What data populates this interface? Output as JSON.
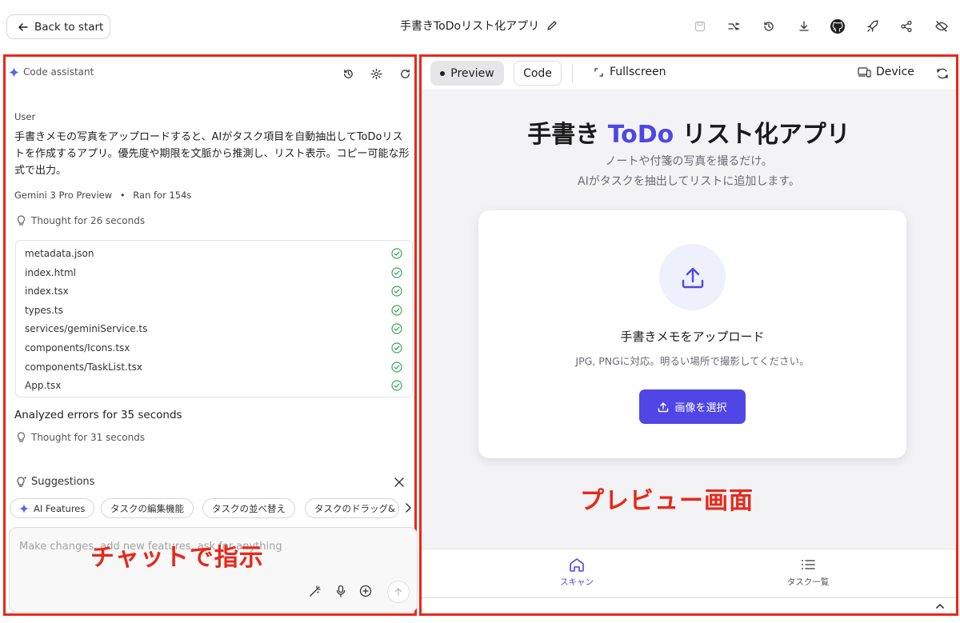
{
  "topbar": {
    "back_label": "Back to start",
    "app_title": "手書きToDoリスト化アプリ"
  },
  "chat": {
    "header_label": "Code assistant",
    "user_label": "User",
    "user_message": "手書きメモの写真をアップロードすると、AIがタスク項目を自動抽出してToDoリストを作成するアプリ。優先度や期限を文脈から推測し、リスト表示。コピー可能な形式で出力。",
    "model_name": "Gemini 3 Pro Preview",
    "run_time": "Ran for 154s",
    "thought_1": "Thought for 26 seconds",
    "files": [
      "metadata.json",
      "index.html",
      "index.tsx",
      "types.ts",
      "services/geminiService.ts",
      "components/Icons.tsx",
      "components/TaskList.tsx",
      "App.tsx"
    ],
    "analyzed": "Analyzed errors for 35 seconds",
    "thought_2": "Thought for 31 seconds",
    "suggestions_title": "Suggestions",
    "suggestions": [
      "AI Features",
      "タスクの編集機能",
      "タスクの並べ替え",
      "タスクのドラッグ&"
    ],
    "input_placeholder": "Make changes, add new features, ask for anything"
  },
  "annotations": {
    "chat": "チャットで指示",
    "preview": "プレビュー画面"
  },
  "preview": {
    "tab_preview": "Preview",
    "tab_code": "Code",
    "fullscreen": "Fullscreen",
    "device": "Device",
    "title_pre": "手書き ",
    "title_accent": "ToDo",
    "title_post": " リスト化アプリ",
    "subtitle_1": "ノートや付箋の写真を撮るだけ。",
    "subtitle_2": "AIがタスクを抽出してリストに追加します。",
    "card_title": "手書きメモをアップロード",
    "card_sub": "JPG, PNGに対応。明るい場所で撮影してください。",
    "select_button": "画像を選択",
    "nav_scan": "スキャン",
    "nav_tasks": "タスク一覧"
  },
  "colors": {
    "accent": "#4f46e5",
    "annotation_red": "#e8281a",
    "success_green": "#3aa757"
  }
}
